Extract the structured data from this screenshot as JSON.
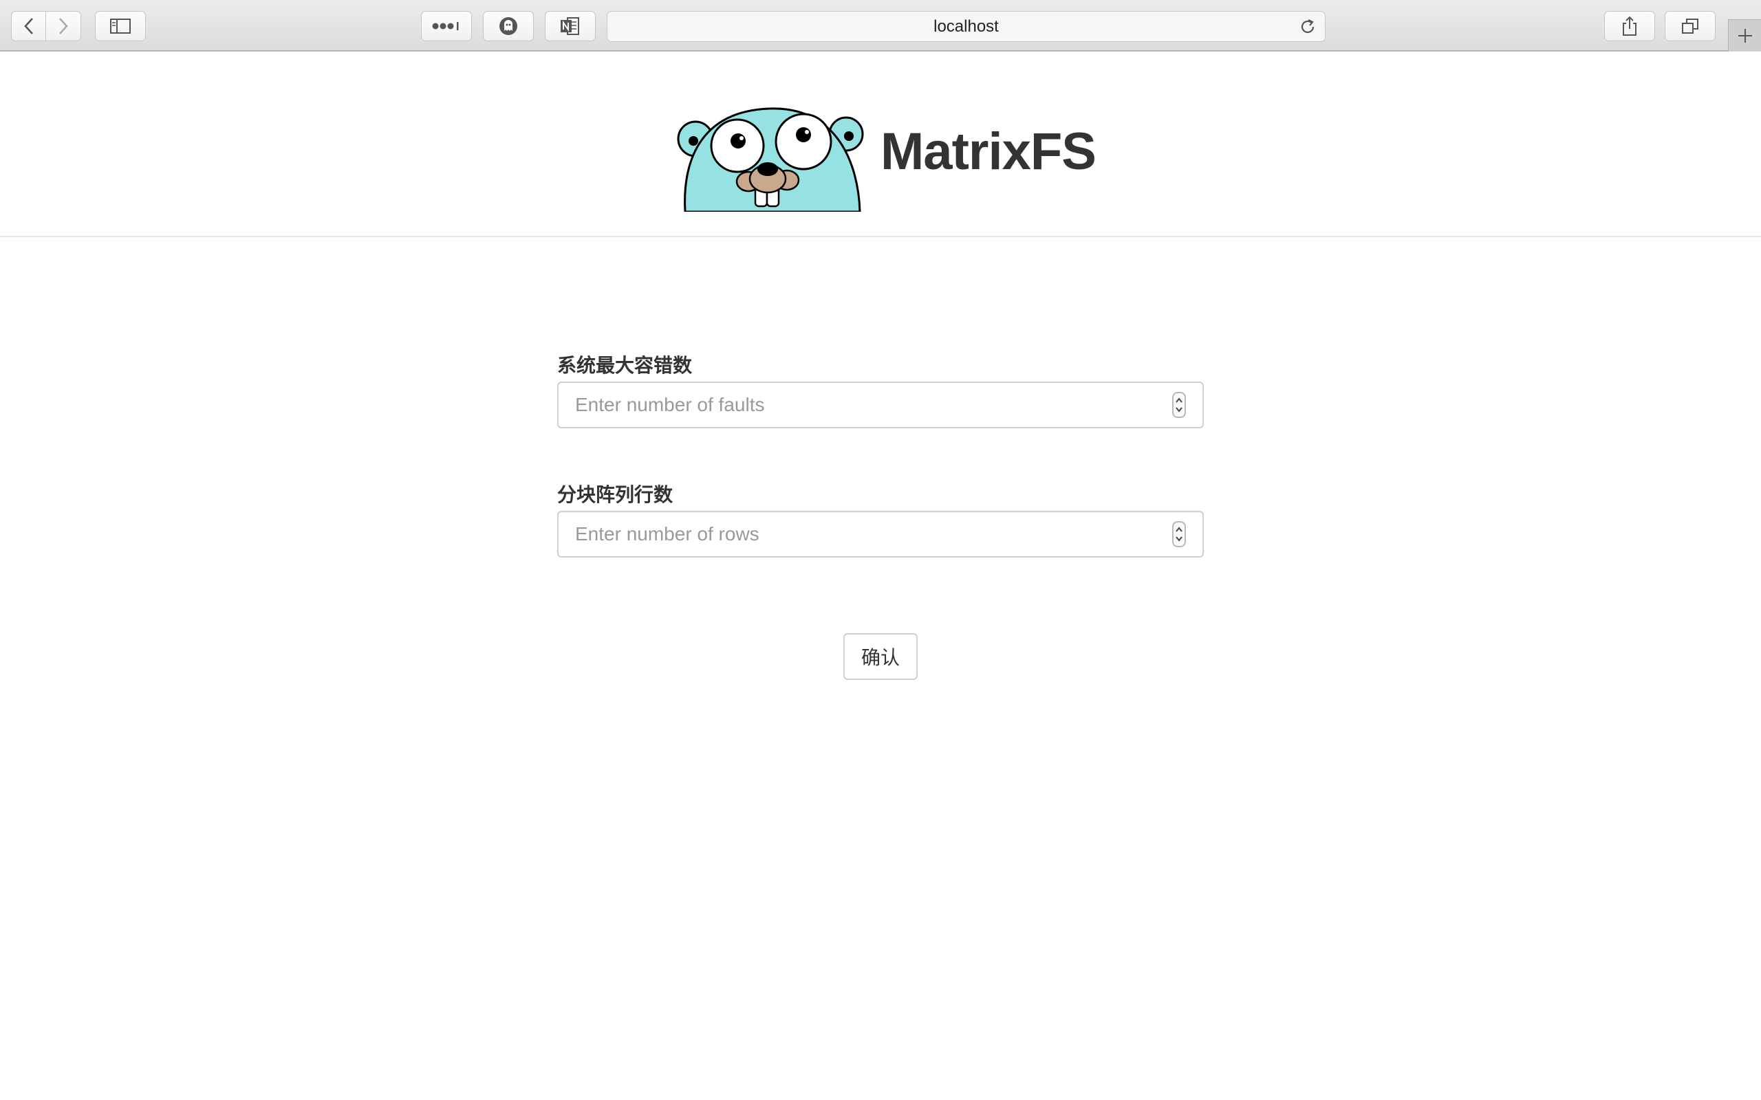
{
  "browser": {
    "url": "localhost",
    "icons": {
      "back": "chevron-left-icon",
      "forward": "chevron-right-icon",
      "sidebar": "sidebar-icon",
      "reader": "more-dots-icon",
      "extension_1": "ghostery-icon",
      "extension_2": "onenote-icon",
      "reload": "reload-icon",
      "share": "share-icon",
      "tabs": "tabs-icon",
      "new_tab": "plus-icon"
    }
  },
  "header": {
    "brand": "MatrixFS",
    "logo": "go-gopher-logo"
  },
  "form": {
    "faults": {
      "label": "系统最大容错数",
      "placeholder": "Enter number of faults",
      "value": ""
    },
    "rows": {
      "label": "分块阵列行数",
      "placeholder": "Enter number of rows",
      "value": ""
    },
    "submit_label": "确认"
  },
  "colors": {
    "gopher": "#96e1e2",
    "text": "#333333",
    "border": "#cfcfcf"
  }
}
